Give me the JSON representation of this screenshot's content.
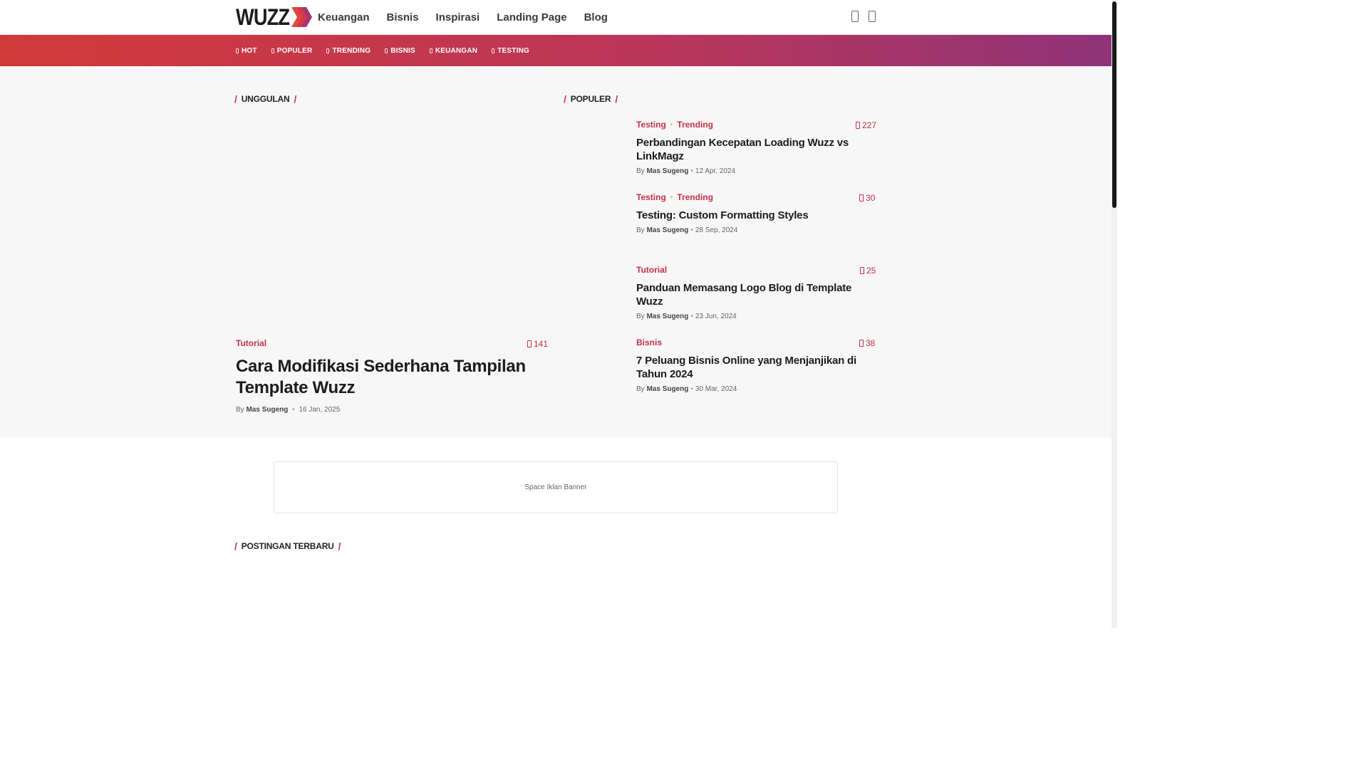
{
  "header": {
    "logo_text": "WUZZ",
    "nav": [
      "Keuangan",
      "Bisnis",
      "Inspirasi",
      "Landing Page",
      "Blog"
    ]
  },
  "tagbar": {
    "tags": [
      "HOT",
      "POPULER",
      "TRENDING",
      "BISNIS",
      "KEUANGAN",
      "TESTING"
    ]
  },
  "featured": {
    "section_title": "UNGGULAN",
    "category": "Tutorial",
    "views": "141",
    "title": "Cara Modifikasi Sederhana Tampilan Template Wuzz",
    "author_prefix": "By",
    "author": "Mas Sugeng",
    "date": "16 Jan, 2025"
  },
  "popular": {
    "section_title": "POPULER",
    "items": [
      {
        "cats": [
          "Testing",
          "Trending"
        ],
        "views": "227",
        "title": "Perbandingan Kecepatan Loading Wuzz vs LinkMagz",
        "author": "Mas Sugeng",
        "date": "12 Apr, 2024"
      },
      {
        "cats": [
          "Testing",
          "Trending"
        ],
        "views": "30",
        "title": "Testing: Custom Formatting Styles",
        "author": "Mas Sugeng",
        "date": "28 Sep, 2024"
      },
      {
        "cats": [
          "Tutorial"
        ],
        "views": "25",
        "title": "Panduan Memasang Logo Blog di Template Wuzz",
        "author": "Mas Sugeng",
        "date": "23 Jun, 2024"
      },
      {
        "cats": [
          "Bisnis"
        ],
        "views": "38",
        "title": "7 Peluang Bisnis Online yang Menjanjikan di Tahun 2024",
        "author": "Mas Sugeng",
        "date": "30 Mar, 2024"
      }
    ]
  },
  "banner": {
    "text": "Space Iklan Banner"
  },
  "latest": {
    "section_title": "POSTINGAN TERBARU"
  },
  "colors": {
    "accent": "#c62f44",
    "gradient_start": "#d23a3a",
    "gradient_end": "#8f3479"
  }
}
